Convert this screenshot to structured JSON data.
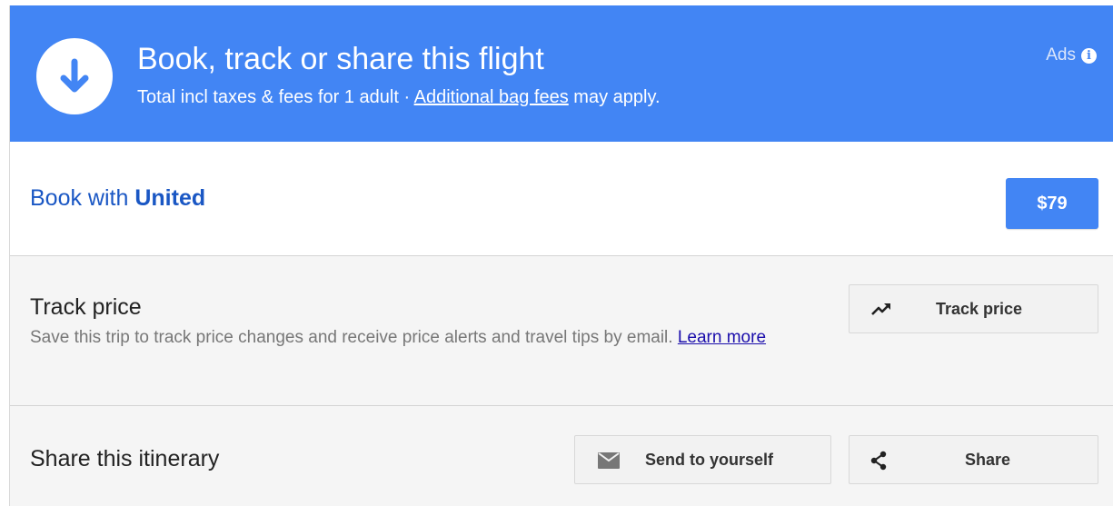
{
  "header": {
    "title": "Book, track or share this flight",
    "subtitle_prefix": "Total incl taxes & fees for 1 adult · ",
    "bag_fees_link": "Additional bag fees",
    "subtitle_suffix": " may apply.",
    "ads_label": "Ads",
    "icon": "download-arrow-icon",
    "color": "#4285f4"
  },
  "book": {
    "prefix": "Book with ",
    "airline": "United",
    "price": "$79"
  },
  "track": {
    "title": "Track price",
    "description": "Save this trip to track price changes and receive price alerts and travel tips by email. ",
    "learn_more": "Learn more",
    "button_label": "Track price",
    "button_icon": "trending-up-icon"
  },
  "share": {
    "title": "Share this itinerary",
    "send_label": "Send to yourself",
    "send_icon": "mail-icon",
    "share_label": "Share",
    "share_icon": "share-icon"
  }
}
